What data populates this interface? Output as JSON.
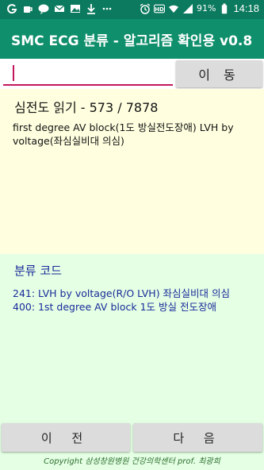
{
  "status_bar": {
    "icons": [
      "g-app-icon",
      "cup-icon",
      "talk-icon",
      "mail-icon",
      "image-icon",
      "download-icon",
      "dots-icon"
    ],
    "right_icons": [
      "alarm-icon",
      "hd-icon",
      "wifi-icon",
      "signal-icon",
      "battery-icon"
    ],
    "battery": "91%",
    "time": "14:18"
  },
  "app_bar": {
    "title": "SMC ECG 분류 - 알고리즘 확인용 v0.8"
  },
  "input": {
    "value": "",
    "goto_label": "이 동"
  },
  "reading": {
    "header": "심전도 읽기 -  573 / 7878",
    "text": "first degree AV block(1도 방실전도장애)    LVH by voltage(좌심실비대 의심)"
  },
  "classification": {
    "header": "분류 코드",
    "items": [
      "241: LVH by voltage(R/O LVH) 좌심실비대 의심",
      "400: 1st degree AV block 1도 방실 전도장애"
    ]
  },
  "nav": {
    "prev_label": "이 전",
    "next_label": "다 음"
  },
  "footer": {
    "copyright": "Copyright 삼성창원병원 건강의학센터 prof. 최광희"
  },
  "colors": {
    "status_bar": "#0b7a5e",
    "app_bar": "#0f8f6c",
    "reading_bg": "#ffffe0",
    "class_bg": "#e4ffe4",
    "accent": "#c2185b",
    "class_text": "#1a2a9a"
  }
}
